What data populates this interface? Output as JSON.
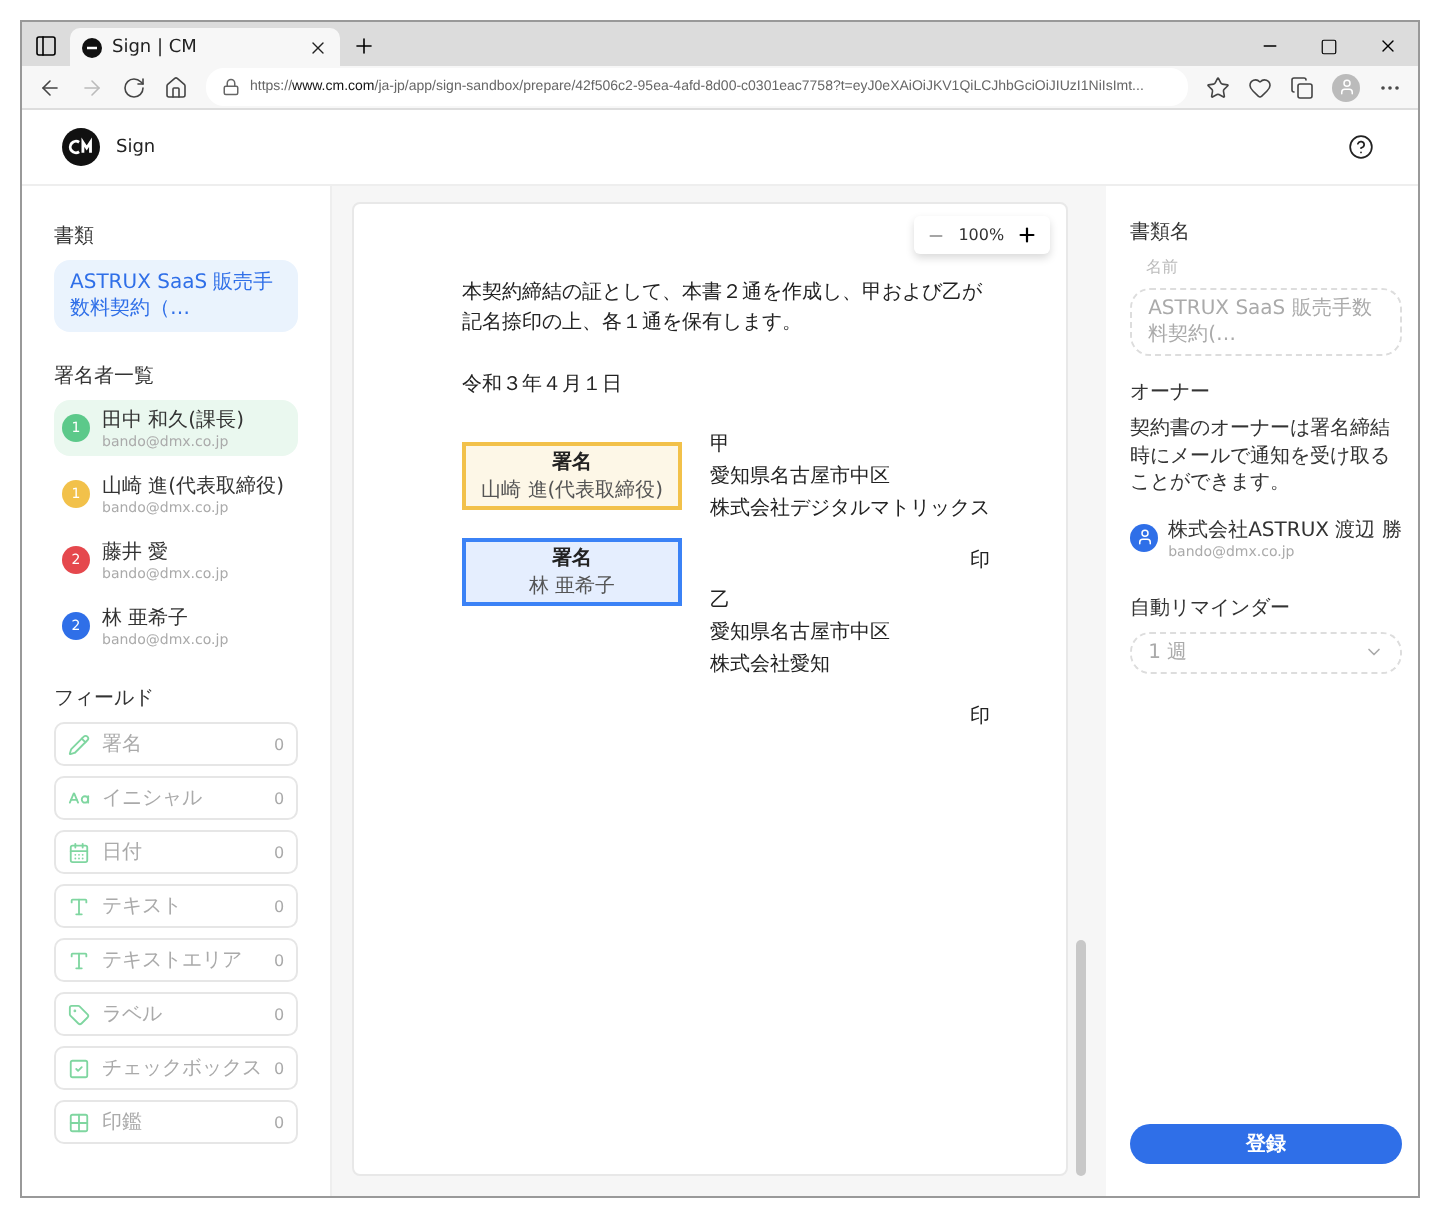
{
  "browser": {
    "tab_title": "Sign | CM",
    "url": "https://**www.cm.com**/ja-jp/app/sign-sandbox/prepare/42f506c2-95ea-4afd-8d00-c0301eac7758?t=eyJ0eXAiOiJKV1QiLCJhbGciOiJIUzI1NiIsImt..."
  },
  "app": {
    "name": "Sign"
  },
  "sidebar": {
    "documents_label": "書類",
    "document": "ASTRUX SaaS 販売手数料契約（…",
    "signers_label": "署名者一覧",
    "signers": [
      {
        "order": "1",
        "name": "田中 和久(課長)",
        "email": "bando@dmx.co.jp",
        "color": "#5cc98a",
        "selected": true
      },
      {
        "order": "1",
        "name": "山崎 進(代表取締役)",
        "email": "bando@dmx.co.jp",
        "color": "#f2c14a",
        "selected": false
      },
      {
        "order": "2",
        "name": "藤井 愛",
        "email": "bando@dmx.co.jp",
        "color": "#e5484d",
        "selected": false
      },
      {
        "order": "2",
        "name": "林 亜希子",
        "email": "bando@dmx.co.jp",
        "color": "#2f6fe8",
        "selected": false
      }
    ],
    "fields_label": "フィールド",
    "fields": [
      {
        "label": "署名",
        "count": "0"
      },
      {
        "label": "イニシャル",
        "count": "0"
      },
      {
        "label": "日付",
        "count": "0"
      },
      {
        "label": "テキスト",
        "count": "0"
      },
      {
        "label": "テキストエリア",
        "count": "0"
      },
      {
        "label": "ラベル",
        "count": "0"
      },
      {
        "label": "チェックボックス",
        "count": "0"
      },
      {
        "label": "印鑑",
        "count": "0"
      }
    ]
  },
  "document": {
    "zoom": "100%",
    "paragraph": "本契約締結の証として、本書２通を作成し、甲および乙が記名捺印の上、各１通を保有します。",
    "date": "令和３年４月１日",
    "signature_boxes": [
      {
        "title": "署名",
        "signer": "山崎 進(代表取締役)",
        "color": "#f2c14a"
      },
      {
        "title": "署名",
        "signer": "林 亜希子",
        "color": "#3b82f6"
      }
    ],
    "parties": [
      {
        "role": "甲",
        "address": "愛知県名古屋市中区",
        "company": "株式会社デジタルマトリックス",
        "seal": "印"
      },
      {
        "role": "乙",
        "address": "愛知県名古屋市中区",
        "company": "株式会社愛知",
        "seal": "印"
      }
    ]
  },
  "details": {
    "doc_name_label": "書類名",
    "name_field": {
      "label": "名前",
      "value": "ASTRUX SaaS 販売手数料契約(…"
    },
    "owner_label": "オーナー",
    "owner_note": "契約書のオーナーは署名締結時にメールで通知を受け取ることができます。",
    "owner": {
      "name": "株式会社ASTRUX 渡辺 勝",
      "email": "bando@dmx.co.jp"
    },
    "reminder_label": "自動リマインダー",
    "reminder": "1 週",
    "submit": "登録"
  }
}
